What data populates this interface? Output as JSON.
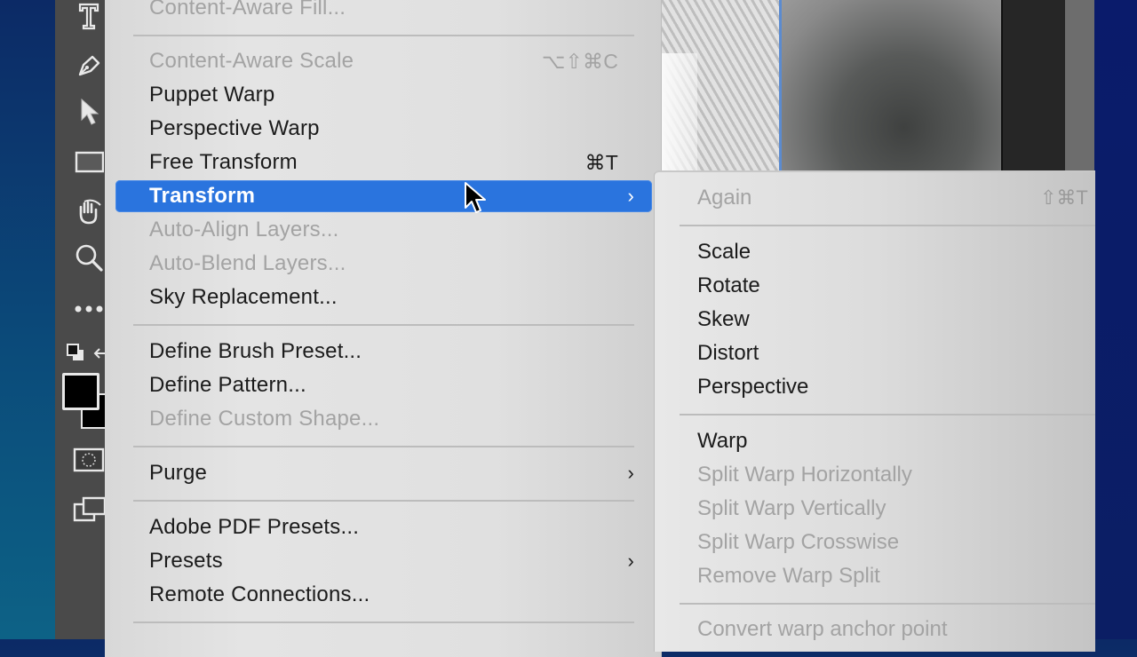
{
  "toolbar": {
    "tools": [
      {
        "name": "type-tool",
        "icon": "type-icon"
      },
      {
        "name": "pen-tool",
        "icon": "pen-icon"
      },
      {
        "name": "path-selection-tool",
        "icon": "arrow-cursor-icon"
      },
      {
        "name": "rectangle-tool",
        "icon": "rectangle-icon"
      },
      {
        "name": "hand-tool",
        "icon": "hand-icon"
      },
      {
        "name": "zoom-tool",
        "icon": "magnifier-icon"
      },
      {
        "name": "more-tools",
        "icon": "ellipsis-icon",
        "label": "•••"
      },
      {
        "name": "default-colors",
        "icon": "default-colors-icon"
      },
      {
        "name": "color-swatches",
        "icon": "foreground-background-icon"
      },
      {
        "name": "quick-mask",
        "icon": "quick-mask-icon"
      },
      {
        "name": "screen-mode",
        "icon": "screen-mode-icon"
      }
    ],
    "foreground_color": "#000000",
    "background_color": "#000000"
  },
  "menu": {
    "items": [
      {
        "label": "Content-Aware Fill...",
        "enabled": false
      },
      {
        "type": "separator"
      },
      {
        "label": "Content-Aware Scale",
        "enabled": false,
        "shortcut": "⌥⇧⌘C"
      },
      {
        "label": "Puppet Warp",
        "enabled": true
      },
      {
        "label": "Perspective Warp",
        "enabled": true
      },
      {
        "label": "Free Transform",
        "enabled": true,
        "shortcut": "⌘T"
      },
      {
        "label": "Transform",
        "enabled": true,
        "submenu": true,
        "highlighted": true,
        "arrow": "›"
      },
      {
        "label": "Auto-Align Layers...",
        "enabled": false
      },
      {
        "label": "Auto-Blend Layers...",
        "enabled": false
      },
      {
        "label": "Sky Replacement...",
        "enabled": true
      },
      {
        "type": "separator"
      },
      {
        "label": "Define Brush Preset...",
        "enabled": true
      },
      {
        "label": "Define Pattern...",
        "enabled": true
      },
      {
        "label": "Define Custom Shape...",
        "enabled": false
      },
      {
        "type": "separator"
      },
      {
        "label": "Purge",
        "enabled": true,
        "submenu": true,
        "arrow": "›"
      },
      {
        "type": "separator"
      },
      {
        "label": "Adobe PDF Presets...",
        "enabled": true
      },
      {
        "label": "Presets",
        "enabled": true,
        "submenu": true,
        "arrow": "›"
      },
      {
        "label": "Remote Connections...",
        "enabled": true
      },
      {
        "type": "separator"
      }
    ]
  },
  "submenu": {
    "parent": "Transform",
    "items": [
      {
        "label": "Again",
        "enabled": false,
        "shortcut": "⇧⌘T"
      },
      {
        "type": "separator"
      },
      {
        "label": "Scale",
        "enabled": true
      },
      {
        "label": "Rotate",
        "enabled": true
      },
      {
        "label": "Skew",
        "enabled": true
      },
      {
        "label": "Distort",
        "enabled": true
      },
      {
        "label": "Perspective",
        "enabled": true
      },
      {
        "type": "separator"
      },
      {
        "label": "Warp",
        "enabled": true
      },
      {
        "label": "Split Warp Horizontally",
        "enabled": false
      },
      {
        "label": "Split Warp Vertically",
        "enabled": false
      },
      {
        "label": "Split Warp Crosswise",
        "enabled": false
      },
      {
        "label": "Remove Warp Split",
        "enabled": false
      },
      {
        "type": "separator"
      },
      {
        "label": "Convert warp anchor point",
        "enabled": false
      }
    ]
  },
  "colors": {
    "highlight": "#2a74de",
    "menu_text": "#1b1b1b",
    "disabled_text": "#a3a3a3"
  }
}
